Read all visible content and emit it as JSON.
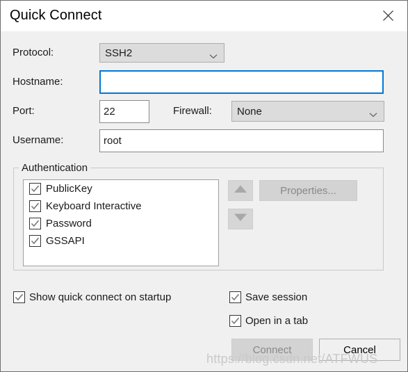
{
  "window": {
    "title": "Quick Connect",
    "close_icon": "close-icon"
  },
  "form": {
    "protocol": {
      "label": "Protocol:",
      "value": "SSH2",
      "chevron_icon": "chevron-down-icon"
    },
    "hostname": {
      "label": "Hostname:",
      "value": "",
      "placeholder": ""
    },
    "port": {
      "label": "Port:",
      "value": "22"
    },
    "firewall": {
      "label": "Firewall:",
      "value": "None",
      "chevron_icon": "chevron-down-icon"
    },
    "username": {
      "label": "Username:",
      "value": "root"
    }
  },
  "authentication": {
    "legend": "Authentication",
    "items": [
      {
        "label": "PublicKey",
        "checked": true
      },
      {
        "label": "Keyboard Interactive",
        "checked": true
      },
      {
        "label": "Password",
        "checked": true
      },
      {
        "label": "GSSAPI",
        "checked": true
      }
    ],
    "move_up_icon": "arrow-up-icon",
    "move_down_icon": "arrow-down-icon",
    "properties_button": "Properties..."
  },
  "options": {
    "show_on_startup": {
      "label": "Show quick connect on startup",
      "checked": true
    },
    "save_session": {
      "label": "Save session",
      "checked": true
    },
    "open_in_tab": {
      "label": "Open in a tab",
      "checked": true
    }
  },
  "footer": {
    "connect_label": "Connect",
    "cancel_label": "Cancel"
  },
  "watermark": "https://blog.csdn.net/ATFWUS",
  "colors": {
    "accent_blue": "#0078d7",
    "dialog_bg": "#f0f0f0",
    "titlebar_bg": "#ffffff",
    "control_gray": "#dcdcdc",
    "check_gray": "#7a7a7a",
    "disabled_text": "#888888"
  }
}
